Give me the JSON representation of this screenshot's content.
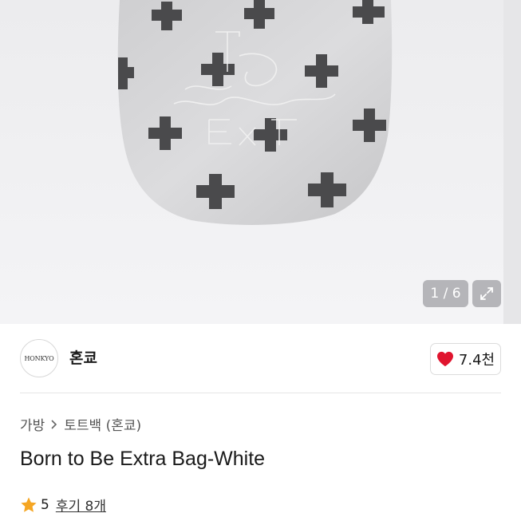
{
  "gallery": {
    "counter": "1 / 6",
    "expand_icon": "expand-arrows-icon"
  },
  "seller": {
    "avatar_text": "HONKYO",
    "name": "혼쿄",
    "like_icon": "heart-icon",
    "like_count": "7.4천",
    "colors": {
      "heart": "#e0142e"
    }
  },
  "breadcrumb": {
    "items": [
      "가방",
      "토트백 (혼쿄)"
    ],
    "separator_icon": "chevron-right-icon"
  },
  "product": {
    "title": "Born to Be Extra Bag-White"
  },
  "rating": {
    "star_icon": "star-icon",
    "value": "5",
    "reviews_label": "후기 8개",
    "colors": {
      "star": "#f5a623"
    }
  }
}
